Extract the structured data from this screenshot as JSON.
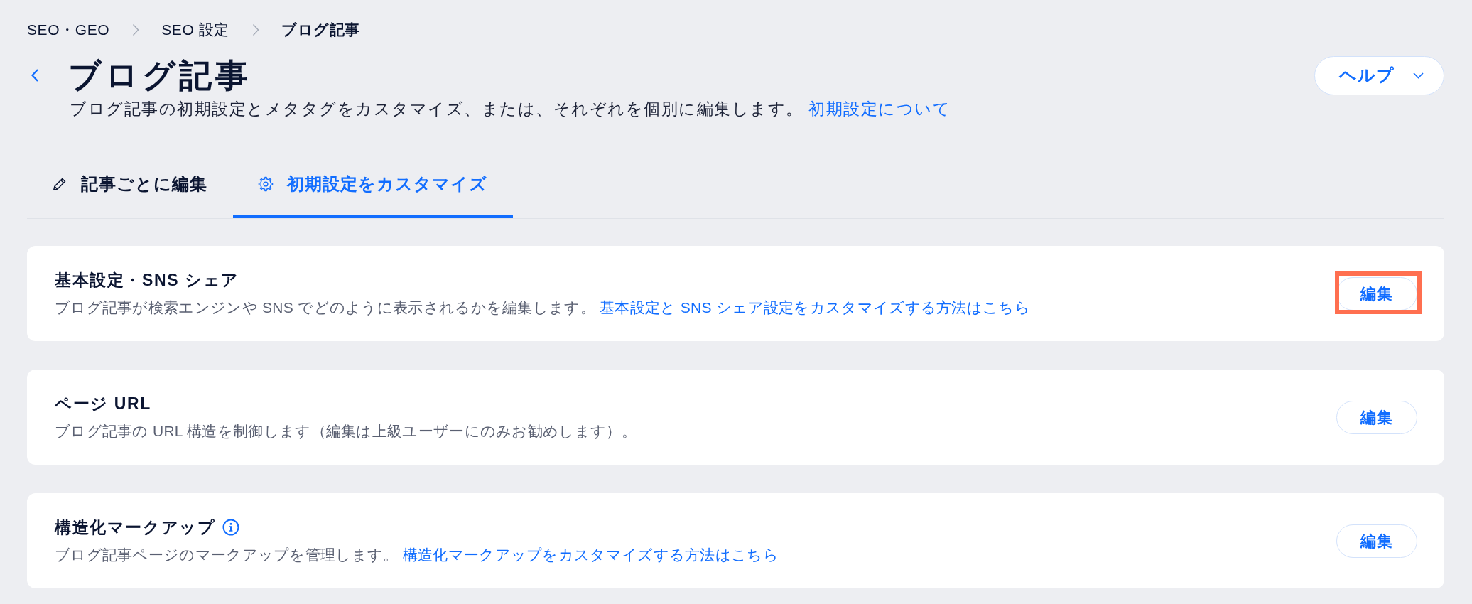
{
  "breadcrumb": [
    {
      "label": "SEO・GEO",
      "current": false
    },
    {
      "label": "SEO 設定",
      "current": false
    },
    {
      "label": "ブログ記事",
      "current": true
    }
  ],
  "header": {
    "title": "ブログ記事",
    "description": "ブログ記事の初期設定とメタタグをカスタマイズ、または、それぞれを個別に編集します。",
    "link": "初期設定について",
    "help_button": "ヘルプ"
  },
  "tabs": [
    {
      "label": "記事ごとに編集",
      "selected": false
    },
    {
      "label": "初期設定をカスタマイズ",
      "selected": true
    }
  ],
  "sections": [
    {
      "title": "基本設定・SNS シェア",
      "info": false,
      "description": "ブログ記事が検索エンジンや SNS でどのように表示されるかを編集します。",
      "link": "基本設定と SNS シェア設定をカスタマイズする方法はこちら",
      "button": "編集",
      "highlighted": true
    },
    {
      "title": "ページ URL",
      "info": false,
      "description": "ブログ記事の URL 構造を制御します（編集は上級ユーザーにのみお勧めします）。",
      "button": "編集",
      "highlighted": false
    },
    {
      "title": "構造化マークアップ",
      "info": true,
      "description": "ブログ記事ページのマークアップを管理します。",
      "link": "構造化マークアップをカスタマイズする方法はこちら",
      "button": "編集",
      "highlighted": false
    }
  ]
}
